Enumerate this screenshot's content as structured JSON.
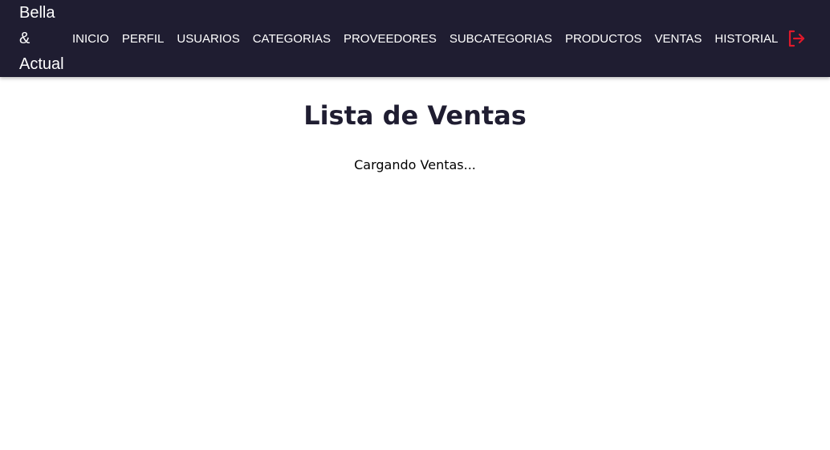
{
  "brand": {
    "line1": "Bella",
    "line2": "&",
    "line3": "Actual"
  },
  "nav": {
    "items": [
      {
        "label": "INICIO"
      },
      {
        "label": "PERFIL"
      },
      {
        "label": "USUARIOS"
      },
      {
        "label": "CATEGORIAS"
      },
      {
        "label": "PROVEEDORES"
      },
      {
        "label": "SUBCATEGORIAS"
      },
      {
        "label": "PRODUCTOS"
      },
      {
        "label": "VENTAS"
      },
      {
        "label": "HISTORIAL"
      }
    ],
    "logout_icon": "logout-icon",
    "logout_color": "#e0192b"
  },
  "main": {
    "title": "Lista de Ventas",
    "loading_text": "Cargando Ventas..."
  },
  "colors": {
    "navbar_bg": "#1f1d31",
    "title_color": "#1f1d31"
  }
}
